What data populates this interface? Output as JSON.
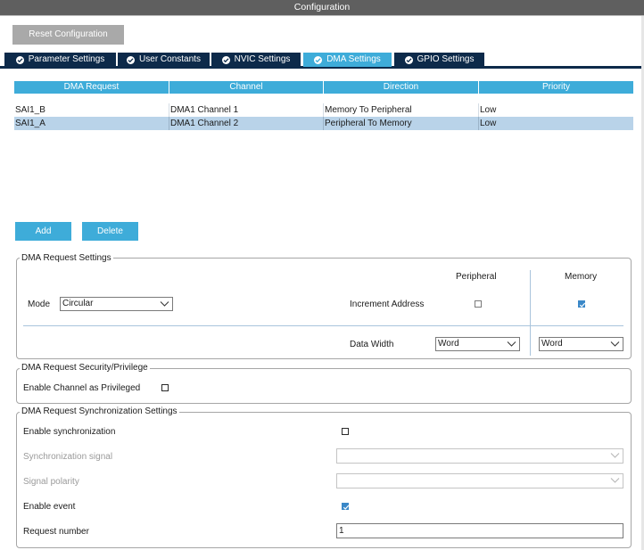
{
  "window": {
    "title": "Configuration"
  },
  "toolbar": {
    "reset_label": "Reset Configuration"
  },
  "tabs": [
    {
      "label": "Parameter Settings",
      "active": false
    },
    {
      "label": "User Constants",
      "active": false
    },
    {
      "label": "NVIC Settings",
      "active": false
    },
    {
      "label": "DMA Settings",
      "active": true
    },
    {
      "label": "GPIO Settings",
      "active": false
    }
  ],
  "dma_table": {
    "columns": [
      "DMA Request",
      "Channel",
      "Direction",
      "Priority"
    ],
    "rows": [
      {
        "request": "SAI1_B",
        "channel": "DMA1 Channel 1",
        "direction": "Memory To Peripheral",
        "priority": "Low",
        "selected": false
      },
      {
        "request": "SAI1_A",
        "channel": "DMA1 Channel 2",
        "direction": "Peripheral To Memory",
        "priority": "Low",
        "selected": true
      }
    ]
  },
  "buttons": {
    "add_label": "Add",
    "delete_label": "Delete"
  },
  "request_settings": {
    "legend": "DMA Request Settings",
    "peripheral_header": "Peripheral",
    "memory_header": "Memory",
    "mode_label": "Mode",
    "mode_value": "Circular",
    "increment_label": "Increment Address",
    "increment_peripheral": false,
    "increment_memory": true,
    "data_width_label": "Data Width",
    "data_width_peripheral": "Word",
    "data_width_memory": "Word"
  },
  "security": {
    "legend": "DMA Request Security/Privilege",
    "privileged_label": "Enable Channel as Privileged",
    "privileged": false
  },
  "sync": {
    "legend": "DMA Request Synchronization Settings",
    "enable_sync_label": "Enable synchronization",
    "enable_sync": false,
    "signal_label": "Synchronization signal",
    "signal_value": "",
    "polarity_label": "Signal polarity",
    "polarity_value": "",
    "enable_event_label": "Enable event",
    "enable_event": true,
    "request_number_label": "Request number",
    "request_number_value": "1"
  },
  "colors": {
    "accent": "#3eacd9",
    "tab_dark": "#0d2a4a",
    "row_selected": "#b9d3e9",
    "title_bar": "#5f5f5f"
  }
}
